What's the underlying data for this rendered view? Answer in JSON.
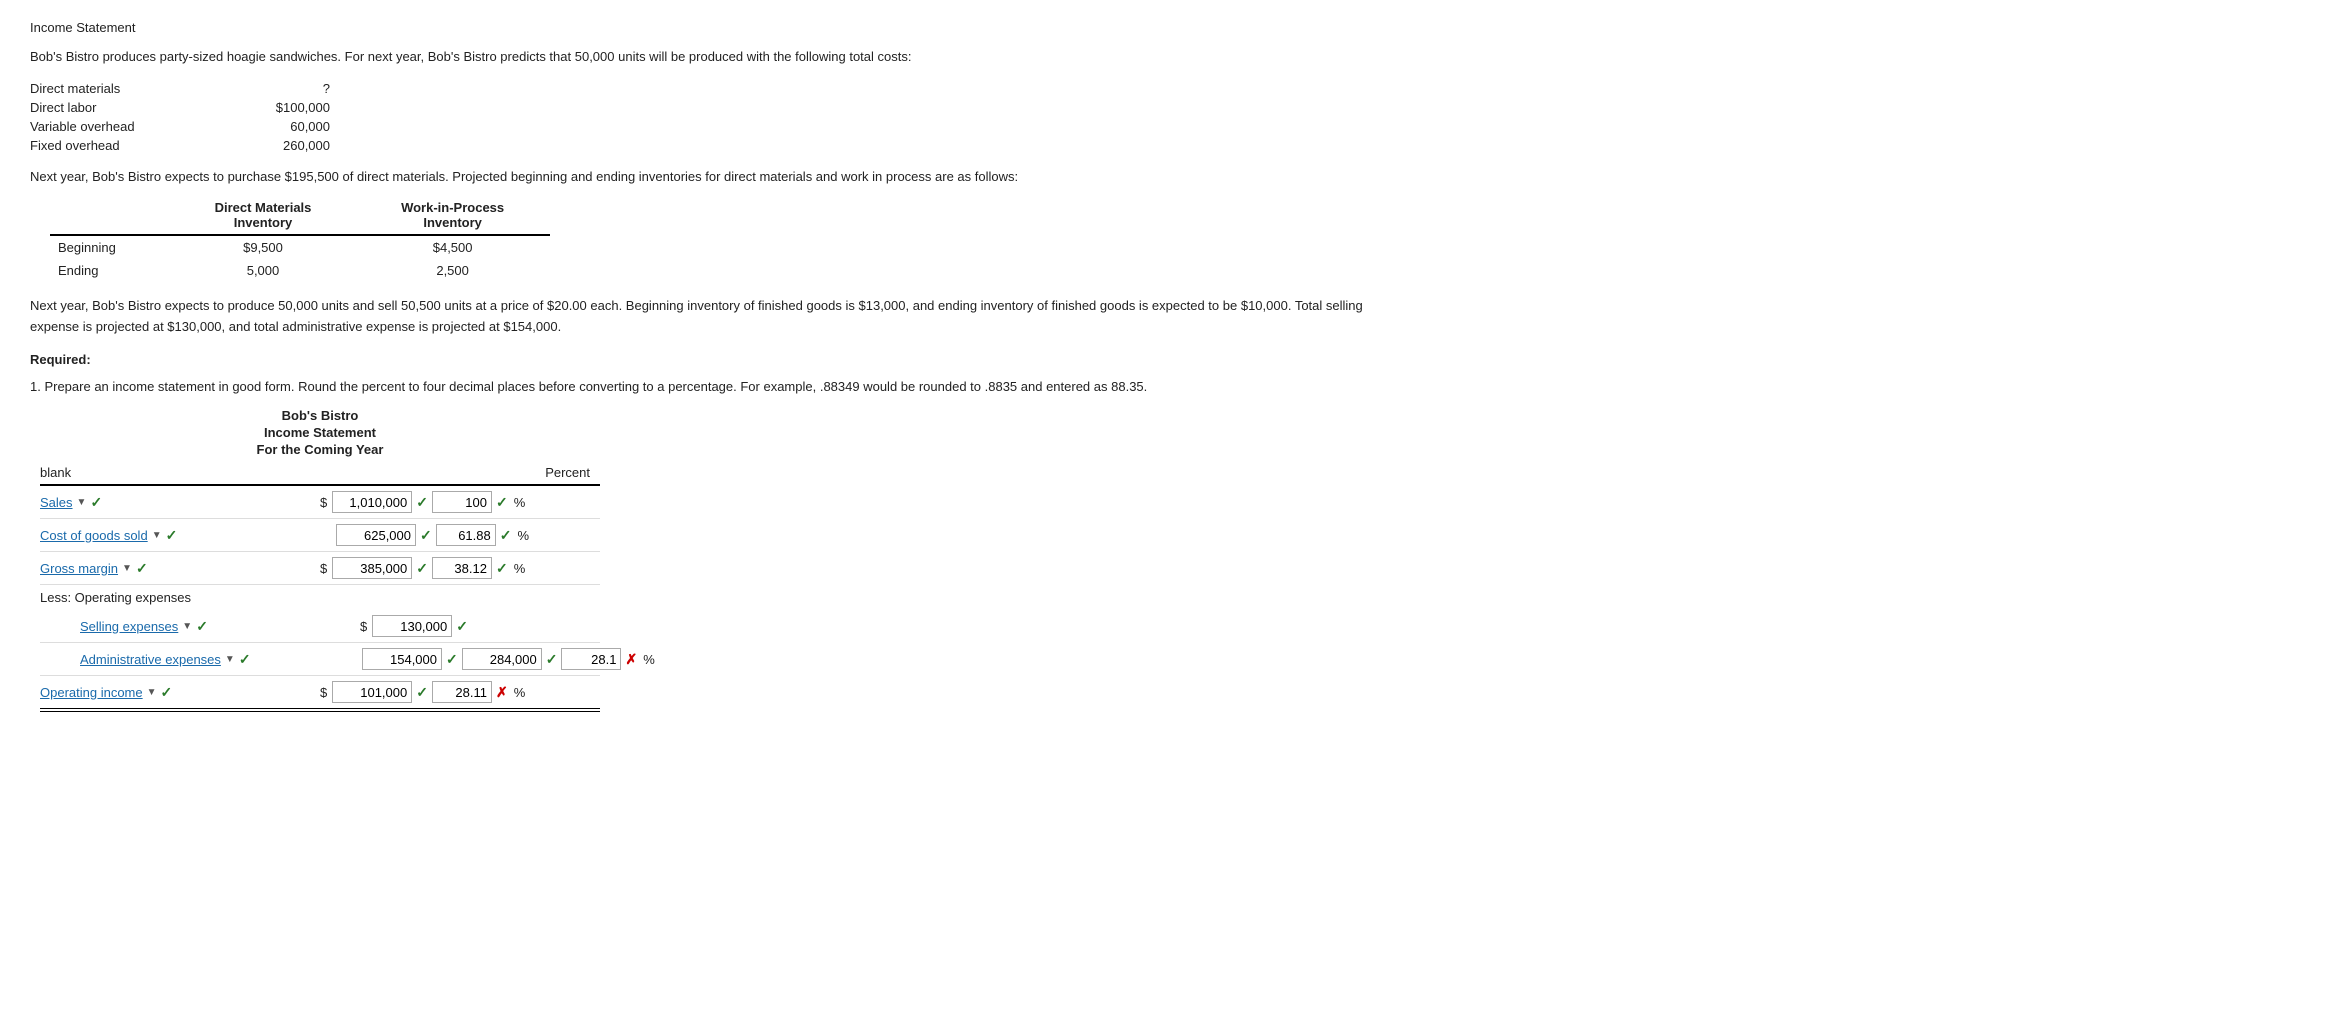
{
  "page": {
    "title": "Income Statement",
    "intro": "Bob's Bistro produces party-sized hoagie sandwiches. For next year, Bob's Bistro predicts that 50,000 units will be produced with the following total costs:",
    "costs": [
      {
        "label": "Direct materials",
        "value": "?"
      },
      {
        "label": "Direct labor",
        "value": "$100,000"
      },
      {
        "label": "Variable overhead",
        "value": "60,000"
      },
      {
        "label": "Fixed overhead",
        "value": "260,000"
      }
    ],
    "inventory_text": "Next year, Bob's Bistro expects to purchase $195,500 of direct materials. Projected beginning and ending inventories for direct materials and work in process are as follows:",
    "inv_headers": [
      "",
      "Direct Materials\nInventory",
      "Work-in-Process\nInventory"
    ],
    "inv_header1": "Direct Materials",
    "inv_header2": "Work-in-Process",
    "inv_subheader1": "Inventory",
    "inv_subheader2": "Inventory",
    "inv_rows": [
      {
        "label": "Beginning",
        "dm": "$9,500",
        "wip": "$4,500"
      },
      {
        "label": "Ending",
        "dm": "5,000",
        "wip": "2,500"
      }
    ],
    "scenario_text": "Next year, Bob's Bistro expects to produce 50,000 units and sell 50,500 units at a price of $20.00 each. Beginning inventory of finished goods is $13,000, and ending inventory of finished goods is expected to be $10,000. Total selling expense is projected at $130,000, and total administrative expense is projected at $154,000.",
    "required_label": "Required:",
    "instruction": "1. Prepare an income statement in good form. Round the percent to four decimal places before converting to a percentage. For example, .88349 would be rounded to .8835 and entered as 88.35.",
    "statement": {
      "company": "Bob's Bistro",
      "title": "Income Statement",
      "period": "For the Coming Year",
      "blank_label": "blank",
      "percent_header": "Percent",
      "rows": [
        {
          "label": "Sales",
          "has_dollar": true,
          "amount": "1,010,000",
          "amount_check": true,
          "percent": "100",
          "percent_check": true,
          "percent_cross": false
        },
        {
          "label": "Cost of goods sold",
          "has_dollar": false,
          "amount": "625,000",
          "amount_check": true,
          "percent": "61.88",
          "percent_check": true,
          "percent_cross": false
        },
        {
          "label": "Gross margin",
          "has_dollar": true,
          "amount": "385,000",
          "amount_check": true,
          "percent": "38.12",
          "percent_check": true,
          "percent_cross": false
        }
      ],
      "less_label": "Less: Operating expenses",
      "selling": {
        "label": "Selling expenses",
        "sub_amount": "130,000",
        "sub_check": true
      },
      "admin": {
        "label": "Administrative expenses",
        "sub_amount": "154,000",
        "sub_check": true,
        "amount": "284,000",
        "amount_check": true,
        "percent": "28.1",
        "percent_cross": true
      },
      "operating": {
        "label": "Operating income",
        "has_dollar": true,
        "amount": "101,000",
        "amount_check": true,
        "percent": "28.11",
        "percent_cross": true
      }
    }
  }
}
